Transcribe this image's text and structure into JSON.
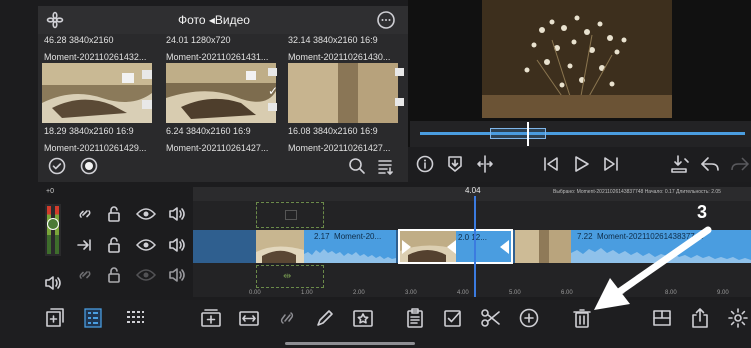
{
  "browser": {
    "title": "Фото ◂Видео",
    "top_row_meta": [
      "46.28 3840x2160",
      "24.01 1280x720",
      "32.14 3840x2160 16:9"
    ],
    "thumbnails": [
      {
        "name": "Moment-202110261432...",
        "meta": "18.29  3840x2160  16:9",
        "selected": false
      },
      {
        "name": "Moment-202110261431...",
        "meta": "6.24  3840x2160  16:9",
        "selected": true
      },
      {
        "name": "Moment-202110261430...",
        "meta": "16.08  3840x2160  16:9",
        "selected": false
      }
    ],
    "bottom_names": [
      "Moment-202110261429...",
      "Moment-202110261427...",
      "Moment-202110261427..."
    ]
  },
  "preview": {
    "playhead_fraction": 0.35
  },
  "timeline": {
    "playhead_time": "4.04",
    "info_line": "Выбрано: Moment-20211026143837748  Начало: 0.17  Длительность: 2.05",
    "track_gain_label": "+0",
    "clips": [
      {
        "duration": "2.17",
        "name": "Moment-20..."
      },
      {
        "duration": "2.0",
        "name": "12..."
      },
      {
        "duration": "7.22",
        "name": "Moment-20211026143837748"
      }
    ],
    "ruler_ticks": [
      "0.00",
      "1.00",
      "2.00",
      "3.00",
      "4.00",
      "5.00",
      "6.00",
      "7.00",
      "8.00",
      "9.00"
    ]
  },
  "annotation": {
    "step_number": "3",
    "color": "#ffffff"
  },
  "colors": {
    "accent": "#4a9de0",
    "playhead": "#3b7be0",
    "background": "#1c1c1e"
  },
  "icons": {
    "toolbar": [
      "add-media-icon",
      "list-view-icon",
      "grid-view-icon",
      "add-clip-icon",
      "split-view-icon",
      "link-icon",
      "pencil-icon",
      "star-frame-icon",
      "clipboard-icon",
      "checkbox-icon",
      "scissors-icon",
      "plus-circle-icon",
      "trash-icon",
      "layout-icon",
      "share-icon",
      "settings-icon"
    ]
  }
}
